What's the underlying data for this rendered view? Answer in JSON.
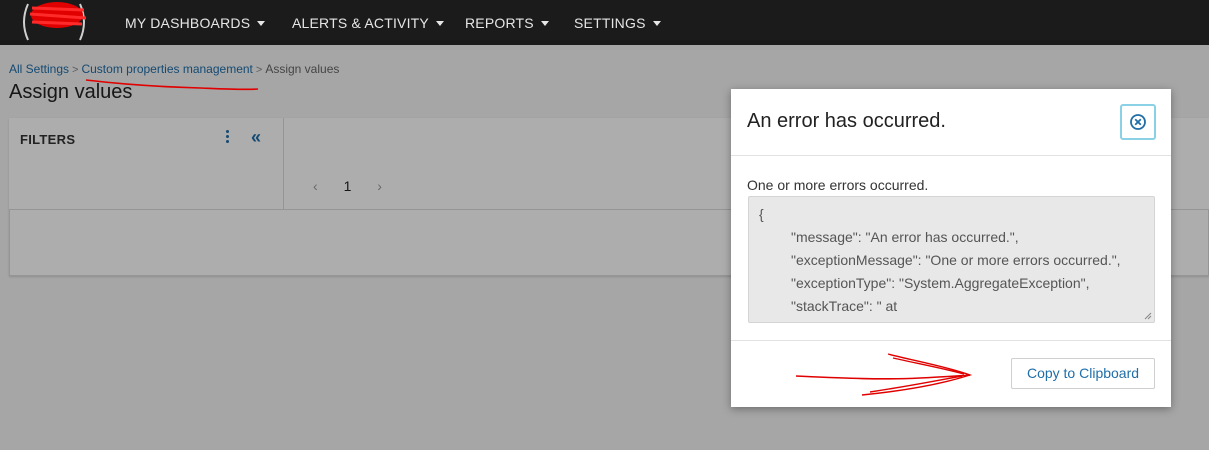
{
  "nav": {
    "items": [
      {
        "label": "MY DASHBOARDS"
      },
      {
        "label": "ALERTS & ACTIVITY"
      },
      {
        "label": "REPORTS"
      },
      {
        "label": "SETTINGS"
      }
    ]
  },
  "breadcrumb": {
    "items": [
      "All Settings",
      "Custom properties management",
      "Assign values"
    ],
    "separator": ">"
  },
  "page": {
    "title": "Assign values"
  },
  "filters": {
    "title": "FILTERS",
    "collapse_glyph": "«"
  },
  "pager": {
    "prev": "‹",
    "current": "1",
    "next": "›"
  },
  "modal": {
    "title": "An error has occurred.",
    "message": "One or more errors occurred.",
    "error_lines": [
      "{",
      "\"message\": \"An error has occurred.\",",
      "\"exceptionMessage\": \"One or more errors occurred.\",",
      "\"exceptionType\": \"System.AggregateException\",",
      "\"stackTrace\": \"   at"
    ],
    "copy_label": "Copy to Clipboard"
  },
  "colors": {
    "nav_bg": "#1b1b1b",
    "link": "#1f6ea8",
    "close_border": "#8ad1e6",
    "annotation_red": "#e00000"
  },
  "icons": {
    "caret": "chevron-down-icon",
    "kebab": "vertical-dots-icon",
    "collapse": "double-chevron-left-icon",
    "close": "close-circle-icon"
  }
}
